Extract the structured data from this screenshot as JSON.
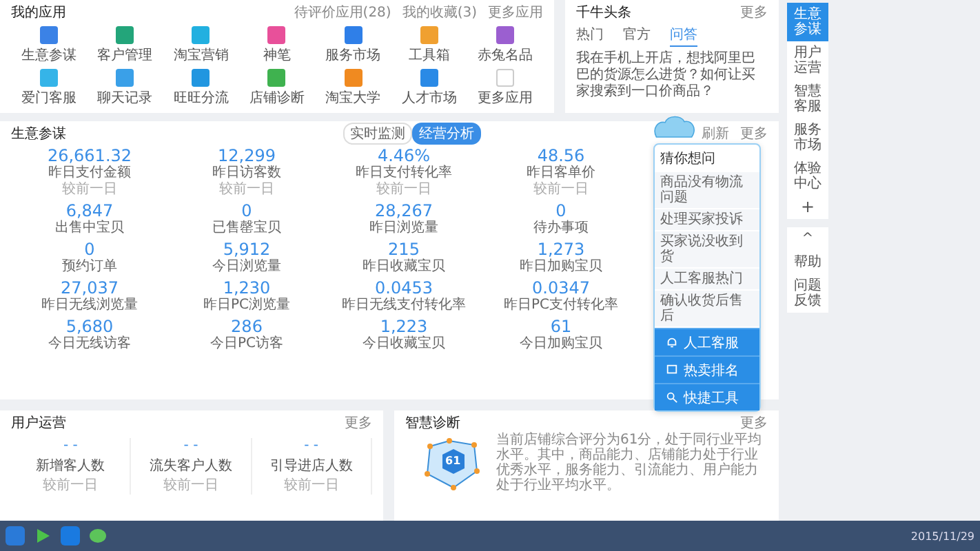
{
  "apps": {
    "title": "我的应用",
    "links": [
      "待评价应用(28)",
      "我的收藏(3)",
      "更多应用"
    ],
    "items": [
      {
        "label": "生意参谋",
        "color": "#3b82e6"
      },
      {
        "label": "客户管理",
        "color": "#23a57a"
      },
      {
        "label": "淘宝营销",
        "color": "#22b0e0"
      },
      {
        "label": "神笔",
        "color": "#e8509a"
      },
      {
        "label": "服务市场",
        "color": "#2f7fe8"
      },
      {
        "label": "工具箱",
        "color": "#f0a030"
      },
      {
        "label": "赤兔名品",
        "color": "#9b5fd0"
      },
      {
        "label": "爱门客服",
        "color": "#35b4e8"
      },
      {
        "label": "聊天记录",
        "color": "#3aa0e8"
      },
      {
        "label": "旺旺分流",
        "color": "#2196e0"
      },
      {
        "label": "店铺诊断",
        "color": "#3fb24f"
      },
      {
        "label": "淘宝大学",
        "color": "#f08a20"
      },
      {
        "label": "人才市场",
        "color": "#2a8ae6"
      },
      {
        "label": "更多应用",
        "color": "#ffffff"
      }
    ]
  },
  "news": {
    "title": "千牛头条",
    "more": "更多",
    "tabs": [
      {
        "label": "热门",
        "selected": false
      },
      {
        "label": "官方",
        "selected": false
      },
      {
        "label": "问答",
        "selected": true
      }
    ],
    "text": "我在手机上开店，想找阿里巴巴的货源怎么进货？如何让买家搜索到一口价商品？"
  },
  "side_nav": [
    {
      "label": "生意参谋",
      "selected": true
    },
    {
      "label": "用户运营",
      "selected": false
    },
    {
      "label": "智慧客服",
      "selected": false
    },
    {
      "label": "服务市场",
      "selected": false
    },
    {
      "label": "体验中心",
      "selected": false
    }
  ],
  "side_add": "+",
  "side_tools": [
    "^",
    "帮助",
    "问题反馈"
  ],
  "metrics": {
    "title": "生意参谋",
    "toggle": [
      {
        "label": "实时监测",
        "selected": false
      },
      {
        "label": "经营分析",
        "selected": true
      }
    ],
    "links": [
      "刷新",
      "更多"
    ],
    "items": [
      {
        "value": "26,661.32",
        "label": "昨日支付金额",
        "compare": "较前一日"
      },
      {
        "value": "12,299",
        "label": "昨日访客数",
        "compare": "较前一日"
      },
      {
        "value": "4.46%",
        "label": "昨日支付转化率",
        "compare": "较前一日"
      },
      {
        "value": "48.56",
        "label": "昨日客单价",
        "compare": "较前一日"
      },
      {
        "value": "6,847",
        "label": "出售中宝贝"
      },
      {
        "value": "0",
        "label": "已售罄宝贝"
      },
      {
        "value": "28,267",
        "label": "昨日浏览量"
      },
      {
        "value": "0",
        "label": "待办事项"
      },
      {
        "value": "0",
        "label": "预约订单"
      },
      {
        "value": "5,912",
        "label": "今日浏览量"
      },
      {
        "value": "215",
        "label": "昨日收藏宝贝"
      },
      {
        "value": "1,273",
        "label": "昨日加购宝贝"
      },
      {
        "value": "27,037",
        "label": "昨日无线浏览量"
      },
      {
        "value": "1,230",
        "label": "昨日PC浏览量"
      },
      {
        "value": "0.0453",
        "label": "昨日无线支付转化率"
      },
      {
        "value": "0.0347",
        "label": "昨日PC支付转化率"
      },
      {
        "value": "5,680",
        "label": "今日无线访客"
      },
      {
        "value": "286",
        "label": "今日PC访客"
      },
      {
        "value": "1,223",
        "label": "今日收藏宝贝"
      },
      {
        "value": "61",
        "label": "今日加购宝贝"
      }
    ]
  },
  "assistant": {
    "title": "猜你想问",
    "questions": [
      "商品没有物流问题",
      "处理买家投诉",
      "买家说没收到货",
      "人工客服热门",
      "确认收货后售后"
    ],
    "actions": [
      {
        "label": "人工客服",
        "kind": "bell"
      },
      {
        "label": "热卖排名",
        "kind": "chat"
      },
      {
        "label": "快捷工具",
        "kind": "tool"
      }
    ]
  },
  "user_ops": {
    "title": "用户运营",
    "more": "更多",
    "stats": [
      {
        "value": "- -",
        "label": "新增客人数",
        "compare": "较前一日"
      },
      {
        "value": "- -",
        "label": "流失客户人数",
        "compare": "较前一日"
      },
      {
        "value": "- -",
        "label": "引导进店人数",
        "compare": "较前一日"
      }
    ]
  },
  "diagnosis": {
    "title": "智慧诊断",
    "more": "更多",
    "score": "61",
    "text": "当前店铺综合评分为61分，处于同行业平均水平。其中，商品能力、店铺能力处于行业优秀水平，服务能力、引流能力、用户能力处于行业平均水平。"
  },
  "taskbar": {
    "date": "2015/11/29"
  }
}
